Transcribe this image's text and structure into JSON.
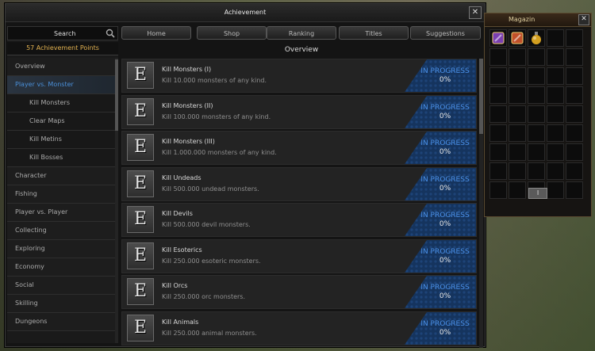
{
  "window": {
    "title": "Achievement",
    "close_icon": "close-icon"
  },
  "sidebar": {
    "search_placeholder": "Search",
    "points": "57 Achievement Points",
    "categories": [
      {
        "label": "Overview",
        "active": false,
        "sub": false
      },
      {
        "label": "Player vs. Monster",
        "active": true,
        "sub": false
      },
      {
        "label": "Kill Monsters",
        "active": false,
        "sub": true
      },
      {
        "label": "Clear Maps",
        "active": false,
        "sub": true
      },
      {
        "label": "Kill Metins",
        "active": false,
        "sub": true
      },
      {
        "label": "Kill Bosses",
        "active": false,
        "sub": true
      },
      {
        "label": "Character",
        "active": false,
        "sub": false
      },
      {
        "label": "Fishing",
        "active": false,
        "sub": false
      },
      {
        "label": "Player vs. Player",
        "active": false,
        "sub": false
      },
      {
        "label": "Collecting",
        "active": false,
        "sub": false
      },
      {
        "label": "Exploring",
        "active": false,
        "sub": false
      },
      {
        "label": "Economy",
        "active": false,
        "sub": false
      },
      {
        "label": "Social",
        "active": false,
        "sub": false
      },
      {
        "label": "Skilling",
        "active": false,
        "sub": false
      },
      {
        "label": "Dungeons",
        "active": false,
        "sub": false
      }
    ]
  },
  "tabs": [
    "Home",
    "Shop",
    "Ranking",
    "Titles",
    "Suggestions"
  ],
  "section_title": "Overview",
  "achievements": [
    {
      "name": "Kill Monsters (I)",
      "desc": "Kill 10.000 monsters of any kind.",
      "status": "IN PROGRESS",
      "progress": "0%"
    },
    {
      "name": "Kill Monsters (II)",
      "desc": "Kill 100.000 monsters of any kind.",
      "status": "IN PROGRESS",
      "progress": "0%"
    },
    {
      "name": "Kill Monsters (III)",
      "desc": "Kill 1.000.000 monsters of any kind.",
      "status": "IN PROGRESS",
      "progress": "0%"
    },
    {
      "name": "Kill Undeads",
      "desc": "Kill 500.000 undead monsters.",
      "status": "IN PROGRESS",
      "progress": "0%"
    },
    {
      "name": "Kill Devils",
      "desc": "Kill 500.000 devil monsters.",
      "status": "IN PROGRESS",
      "progress": "0%"
    },
    {
      "name": "Kill Esoterics",
      "desc": "Kill 250.000 esoteric monsters.",
      "status": "IN PROGRESS",
      "progress": "0%"
    },
    {
      "name": "Kill Orcs",
      "desc": "Kill 250.000 orc monsters.",
      "status": "IN PROGRESS",
      "progress": "0%"
    },
    {
      "name": "Kill Animals",
      "desc": "Kill 250.000 animal monsters.",
      "status": "IN PROGRESS",
      "progress": "0%"
    }
  ],
  "emblem_letter": "E",
  "inventory": {
    "title": "Magazin",
    "page_button": "I",
    "items": [
      {
        "name": "purple-scroll-icon",
        "color": "#7a3fb0"
      },
      {
        "name": "red-gold-scroll-icon",
        "color": "#c0502a"
      },
      {
        "name": "potion-bottle-icon",
        "color": "#d4a020"
      }
    ]
  },
  "colors": {
    "status_blue": "#4a90e8",
    "active_category": "#4a8fd8",
    "points_gold": "#e0b050"
  }
}
